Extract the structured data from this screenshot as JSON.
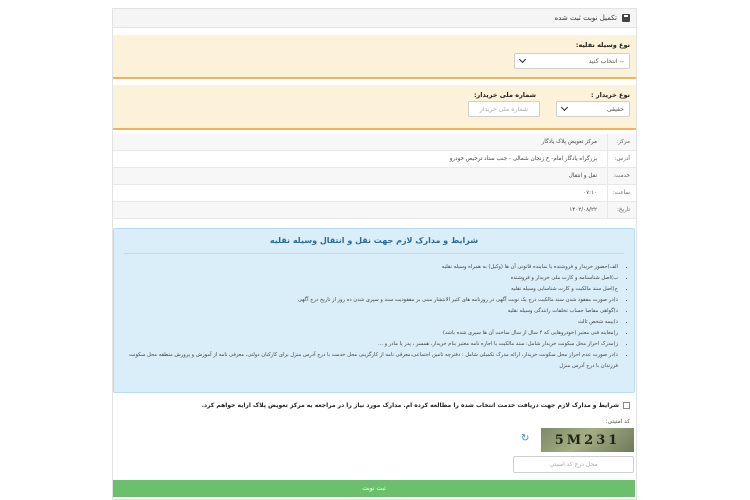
{
  "header": {
    "title": "تکمیل نوبت ثبت شده",
    "icon": "save-icon"
  },
  "vehicle": {
    "label": "نوع وسیله نقلیه:",
    "selected": "-- انتخاب کنید"
  },
  "buyer": {
    "type_label": "نوع خریدار :",
    "type_selected": "حقیقی",
    "national_label": "شماره ملی خریدار:",
    "national_placeholder": "شماره ملی خریدار"
  },
  "info": [
    {
      "label": "مرکز:",
      "value": "مرکز تعویض پلاک یادگار"
    },
    {
      "label": "آدرس:",
      "value": "بزرگراه یادگار امام- خ زنجان شمالی - جنب ستاد ترخیص خودرو"
    },
    {
      "label": "خدمت:",
      "value": "نقل و انتقال"
    },
    {
      "label": "ساعت:",
      "value": "۰۷:۱۰"
    },
    {
      "label": "تاریخ:",
      "value": "۱۴۰۲/۰۸/۲۲"
    }
  ],
  "terms": {
    "title": "شرایط و مدارک لازم جهت نقل و انتقال وسیله نقلیه",
    "items": [
      "الف)حضور خریدار و فروشنده یا نماینده قانونی آن ها (وکیل) به همراه وسیله نقلیه",
      "ب)اصل شناسنامه و کارت ملی خریدار و فروشنده",
      "ج)اصل سند مالکیت و کارت شناسایی وسیله نقلیه",
      "ذ)در صورت مفقود شدن سند مالکیت درج یک نوبت آگهی در روزنامه های کثیر الانتشار مبنی بر مفقودیت سند و سپری شدن ده روز از تاریخ درج آگهی",
      "د)گواهی مفاصا حساب تخلفات رانندگی وسیله نقلیه",
      "ذ)بیمه شخص ثالث",
      "ر)معاینه فنی معتبر (خودروهایی که ۴ سال از سال ساخت آن ها سپری شده باشد)",
      "ز)مدرک احراز محل سکونت خریدار شامل: سند مالکیت یا اجاره نامه معتبر بنام خریدار، همسر ، پدر یا مادر و ...",
      "ذ)در صورت عدم احراز محل سکونت خریدار، ارائه مدرک تکمیلی شامل : دفترچه تامین اجتماعی،معرفی نامه از کارگزینی محل خدمت با درج آدرس منزل برای کارکنان دولتی، معرفی نامه از آموزش و پرورش منطقه محل سکونت فرزندان با درج آدرس منزل"
    ]
  },
  "agreement": "شرایط و مدارک لازم جهت دریافت خدمت انتخاب شده را مطالعه کرده ام. مدارک مورد نیاز را در مراجعه به مرکز تعویض پلاک ارایه خواهم کرد.",
  "captcha": {
    "label": "کد امنیتی:",
    "image_text": "5M231",
    "input_placeholder": "محل درج کد امنیتی",
    "refresh_icon": "refresh-icon"
  },
  "submit_label": "ثبت نوبت",
  "colors": {
    "section_bg": "#fcf2d9",
    "section_border": "#f0b35a",
    "terms_bg": "#d9eef8",
    "terms_title": "#2b6c96",
    "submit_bg": "#6cbf6c"
  }
}
